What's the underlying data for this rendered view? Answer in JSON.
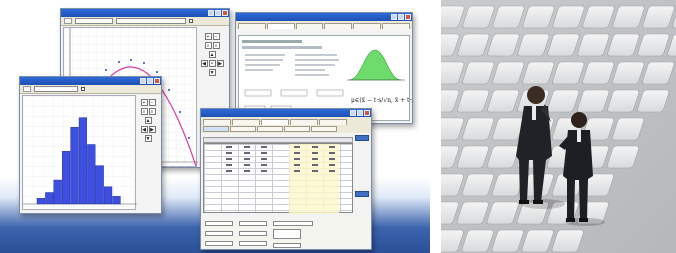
{
  "left_collage": {
    "description_none": "",
    "histogram_bars": [
      0.06,
      0.12,
      0.25,
      0.55,
      0.8,
      0.9,
      0.62,
      0.4,
      0.18,
      0.08
    ],
    "parabola_points": "arc",
    "colors": {
      "title_bar": "#2b5fcc",
      "histogram_bar": "#3d4fe0",
      "parabola": "#d83aa0",
      "bg_gradient": "#2b4f97"
    }
  },
  "right_photo": {
    "subject": "two business figurines on a keyboard"
  }
}
